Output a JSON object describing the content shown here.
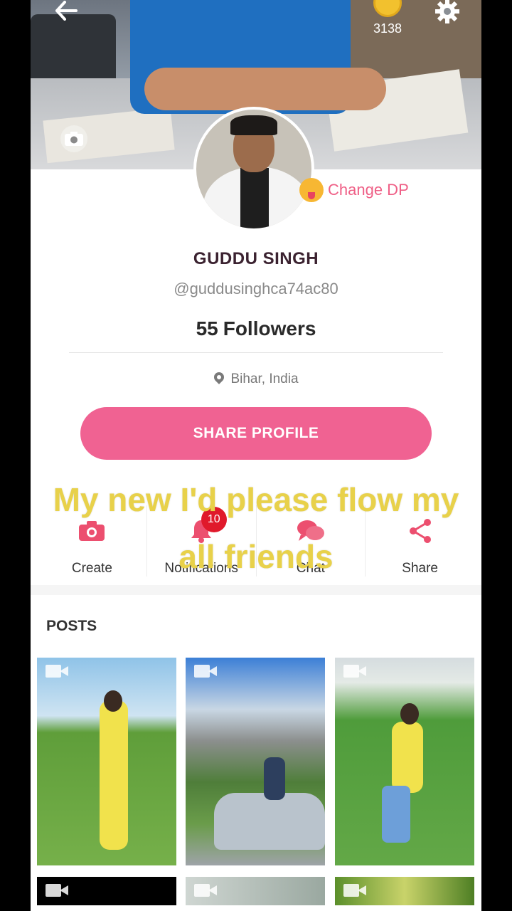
{
  "header": {
    "coin_count": "3138",
    "icons": {
      "back": "back-arrow-icon",
      "settings": "gear-icon",
      "coin": "coin-icon",
      "cover_camera": "camera-icon"
    }
  },
  "profile": {
    "change_dp_label": "Change DP",
    "name": "GUDDU SINGH",
    "handle": "@guddusinghca74ac80",
    "followers_count": "55",
    "followers_label": "Followers",
    "location": "Bihar, India",
    "share_button_label": "SHARE PROFILE"
  },
  "actions": [
    {
      "label": "Create",
      "icon": "camera-icon"
    },
    {
      "label": "Notifications",
      "icon": "bell-icon",
      "badge": "10"
    },
    {
      "label": "Chat",
      "icon": "chat-bubbles-icon"
    },
    {
      "label": "Share",
      "icon": "share-icon"
    }
  ],
  "overlay_caption": {
    "line1": "My new I'd please flow my",
    "line2": "all friends"
  },
  "posts": {
    "title": "POSTS",
    "items": [
      {
        "type": "video"
      },
      {
        "type": "video"
      },
      {
        "type": "video"
      },
      {
        "type": "video"
      },
      {
        "type": "video"
      },
      {
        "type": "video"
      }
    ]
  },
  "colors": {
    "accent_pink": "#f06292",
    "badge_red": "#e0192b",
    "caption_yellow": "#e8d14a"
  }
}
